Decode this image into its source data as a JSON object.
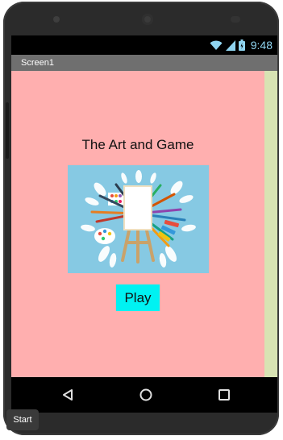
{
  "status_bar": {
    "time": "9:48",
    "icons": [
      "wifi-icon",
      "signal-icon",
      "battery-icon"
    ],
    "icon_color": "#8fd4f0"
  },
  "title_bar": {
    "title": "Screen1"
  },
  "screen": {
    "background": "#ffafaf",
    "title": "The Art and Game",
    "image_name": "art-easel-illustration",
    "play_label": "Play",
    "play_color": "#00f2f2"
  },
  "nav_bar": {
    "icons": [
      "back-icon",
      "home-icon",
      "recent-apps-icon"
    ]
  },
  "start_button": {
    "label": "Start"
  }
}
